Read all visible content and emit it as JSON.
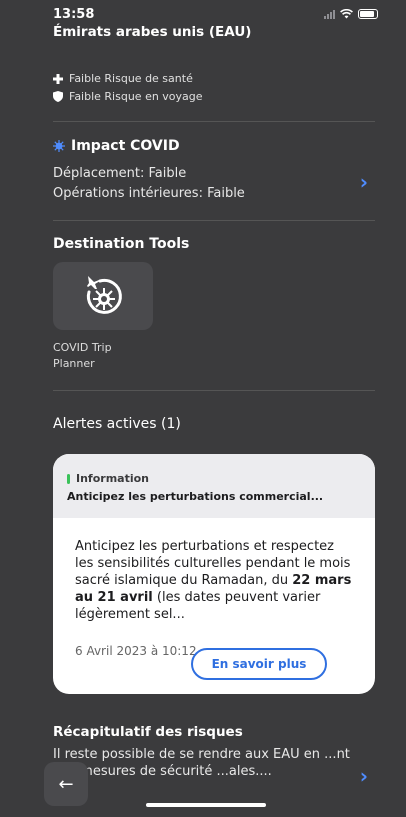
{
  "status_bar": {
    "time": "13:58"
  },
  "country": {
    "name": "Émirats arabes unis (EAU)"
  },
  "risks": {
    "health": {
      "label": "Faible Risque de santé",
      "icon": "medical-cross-icon"
    },
    "travel": {
      "label": "Faible Risque en voyage",
      "icon": "shield-icon"
    }
  },
  "covid": {
    "title": "Impact COVID",
    "icon": "virus-icon",
    "travel": "Déplacement: Faible",
    "domestic": "Opérations intérieures: Faible"
  },
  "destination_tools": {
    "title": "Destination Tools",
    "tool_line1": "COVID Trip",
    "tool_line2": "Planner",
    "tool_icon": "plane-virus-icon"
  },
  "alerts": {
    "title": "Alertes actives (1)",
    "card": {
      "badge": "Information",
      "badge_color": "#3ac25a",
      "subtitle": "Anticipez les perturbations commercial...",
      "body_part1": "Anticipez les perturbations et respectez les sensibilités culturelles pendant le mois sacré islamique du Ramadan, du ",
      "body_bold": "22 mars au 21 avril",
      "body_part2": " (les dates peuvent varier légèrement sel...",
      "date": "6 Avril 2023 à 10:12",
      "button": "En savoir plus"
    }
  },
  "recap": {
    "title": "Récapitulatif des risques",
    "text": "Il reste possible de se rendre aux EAU en ...nt des mesures de sécurité ...ales...."
  },
  "colors": {
    "accent": "#2f6fe0",
    "chevron": "#4f8cff",
    "background": "#3b3b3d"
  }
}
